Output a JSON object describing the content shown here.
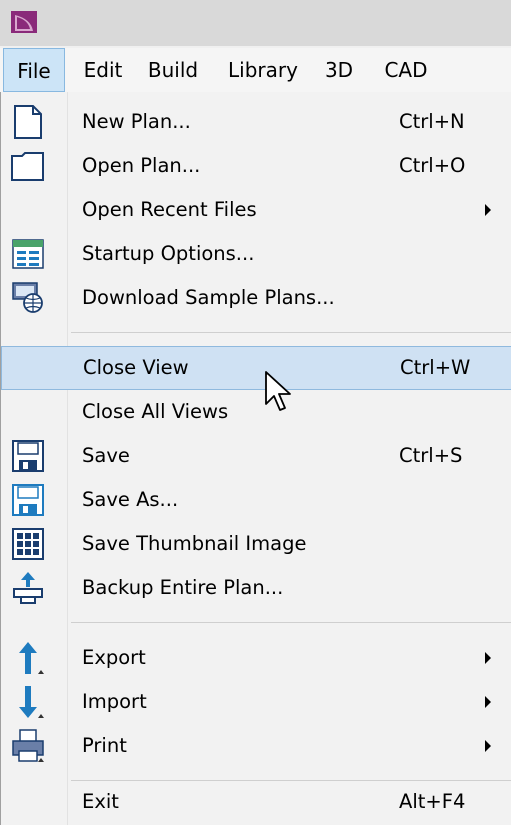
{
  "menubar": {
    "items": [
      {
        "label": "File"
      },
      {
        "label": "Edit"
      },
      {
        "label": "Build"
      },
      {
        "label": "Library"
      },
      {
        "label": "3D"
      },
      {
        "label": "CAD"
      }
    ]
  },
  "file_menu": {
    "items": [
      {
        "label": "New Plan...",
        "shortcut": "Ctrl+N",
        "icon": "new-plan-icon"
      },
      {
        "label": "Open Plan...",
        "shortcut": "Ctrl+O",
        "icon": "open-plan-icon"
      },
      {
        "label": "Open Recent Files",
        "shortcut": "",
        "icon": ""
      },
      {
        "label": "Startup Options...",
        "shortcut": "",
        "icon": "startup-options-icon"
      },
      {
        "label": "Download Sample Plans...",
        "shortcut": "",
        "icon": "download-sample-plans-icon"
      },
      {
        "label": "Close View",
        "shortcut": "Ctrl+W",
        "icon": ""
      },
      {
        "label": "Close All Views",
        "shortcut": "",
        "icon": ""
      },
      {
        "label": "Save",
        "shortcut": "Ctrl+S",
        "icon": "save-icon"
      },
      {
        "label": "Save As...",
        "shortcut": "",
        "icon": "save-as-icon"
      },
      {
        "label": "Save Thumbnail Image",
        "shortcut": "",
        "icon": "thumbnail-icon"
      },
      {
        "label": "Backup Entire Plan...",
        "shortcut": "",
        "icon": "backup-icon"
      },
      {
        "label": "Export",
        "shortcut": "",
        "icon": "export-icon"
      },
      {
        "label": "Import",
        "shortcut": "",
        "icon": "import-icon"
      },
      {
        "label": "Print",
        "shortcut": "",
        "icon": "printer-icon"
      },
      {
        "label": "Exit",
        "shortcut": "Alt+F4",
        "icon": ""
      }
    ],
    "highlighted_item": "Close View"
  },
  "colors": {
    "highlight": "#cfe1f3",
    "highlight_border": "#8fb9de",
    "icon_blue": "#1e7bbf",
    "logo_purple": "#8a2a7a"
  }
}
